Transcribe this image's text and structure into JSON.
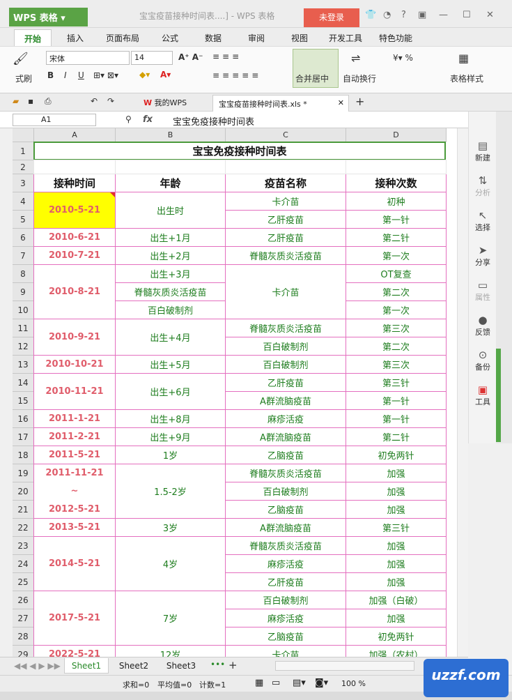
{
  "app": {
    "name": "WPS 表格",
    "doc_title": "宝宝疫苗接种时间表....] - WPS 表格",
    "login": "未登录"
  },
  "ribbon_tabs": [
    "开始",
    "插入",
    "页面布局",
    "公式",
    "数据",
    "审阅",
    "视图",
    "开发工具",
    "特色功能"
  ],
  "ribbon": {
    "format_painter": "式刷",
    "font": "宋体",
    "size": "14",
    "merge": "合并居中",
    "wrap": "自动换行",
    "table_style": "表格样式"
  },
  "doc_tabs": {
    "wps": "我的WPS",
    "file": "宝宝疫苗接种时间表.xls *"
  },
  "formula": {
    "cell": "A1",
    "fx": "fx",
    "content": "宝宝免疫接种时间表"
  },
  "columns": [
    "A",
    "B",
    "C",
    "D"
  ],
  "rows": [
    "1",
    "2",
    "3",
    "4",
    "5",
    "6",
    "7",
    "8",
    "9",
    "10",
    "11",
    "12",
    "13",
    "14",
    "15",
    "16",
    "17",
    "18",
    "19",
    "20",
    "21",
    "22",
    "23",
    "24",
    "25",
    "26",
    "27",
    "28",
    "29"
  ],
  "sheet_title": "宝宝免疫接种时间表",
  "headers": [
    "接种时间",
    "年龄",
    "疫苗名称",
    "接种次数"
  ],
  "table": {
    "a": [
      "2010-5-21",
      "2010-6-21",
      "2010-7-21",
      "2010-8-21",
      "2010-9-21",
      "2010-10-21",
      "2010-11-21",
      "2011-1-21",
      "2011-2-21",
      "2011-5-21",
      "2011-11-21",
      "~",
      "2012-5-21",
      "2013-5-21",
      "2014-5-21",
      "2017-5-21",
      "2022-5-21"
    ],
    "b": [
      "出生时",
      "出生+1月",
      "出生+2月",
      "出生+3月",
      "脊髓灰质炎活疫苗",
      "百白破制剂",
      "出生+4月",
      "出生+5月",
      "出生+6月",
      "出生+8月",
      "出生+9月",
      "1岁",
      "1.5-2岁",
      "3岁",
      "4岁",
      "7岁",
      "12岁"
    ],
    "c": [
      "卡介苗",
      "乙肝疫苗",
      "乙肝疫苗",
      "脊髓灰质炎活疫苗",
      "卡介苗",
      "脊髓灰质炎活疫苗",
      "百白破制剂",
      "百白破制剂",
      "乙肝疫苗",
      "A群流脑疫苗",
      "麻疹活疫",
      "A群流脑疫苗",
      "乙脑疫苗",
      "脊髓灰质炎活疫苗",
      "百白破制剂",
      "乙脑疫苗",
      "A群流脑疫苗",
      "脊髓灰质炎活疫苗",
      "麻疹活疫",
      "乙肝疫苗",
      "百白破制剂",
      "麻疹活疫",
      "乙脑疫苗",
      "卡介苗"
    ],
    "d": [
      "初种",
      "第一针",
      "第二针",
      "第一次",
      "OT复查",
      "第二次",
      "第一次",
      "第三次",
      "第二次",
      "第三次",
      "第三针",
      "第一针",
      "第一针",
      "第二针",
      "初免两针",
      "加强",
      "加强",
      "加强",
      "第三针",
      "加强",
      "加强",
      "加强",
      "加强（白破）",
      "加强",
      "初免两针",
      "加强（农村）"
    ]
  },
  "sidebar": [
    "新建",
    "分析",
    "选择",
    "分享",
    "属性",
    "反馈",
    "备份",
    "工具"
  ],
  "sheets": [
    "Sheet1",
    "Sheet2",
    "Sheet3"
  ],
  "status": {
    "sum": "求和=0",
    "avg": "平均值=0",
    "count": "计数=1",
    "zoom": "100 %"
  },
  "watermark": "uzzf.com"
}
